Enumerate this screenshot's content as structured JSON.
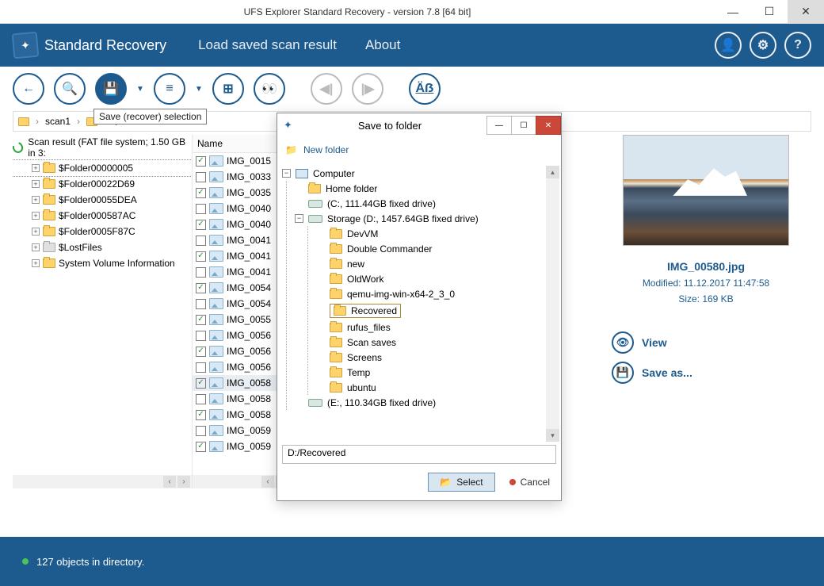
{
  "window": {
    "title": "UFS Explorer Standard Recovery - version 7.8 [64 bit]"
  },
  "banner": {
    "logo": "Standard Recovery",
    "menu_load": "Load saved scan result",
    "menu_about": "About"
  },
  "toolbar": {
    "tooltip_save": "Save (recover) selection"
  },
  "breadcrumb": {
    "item1": "scan1",
    "item2": "$...."
  },
  "tree": {
    "header": "Scan result (FAT file system; 1.50 GB in 3:",
    "items": [
      {
        "label": "$Folder00000005",
        "selected": true
      },
      {
        "label": "$Folder00022D69"
      },
      {
        "label": "$Folder00055DEA"
      },
      {
        "label": "$Folder000587AC"
      },
      {
        "label": "$Folder0005F87C"
      },
      {
        "label": "$LostFiles",
        "gray": true
      },
      {
        "label": "System Volume Information"
      }
    ]
  },
  "list": {
    "header": "Name",
    "items": [
      {
        "label": "IMG_0015",
        "checked": true
      },
      {
        "label": "IMG_0033"
      },
      {
        "label": "IMG_0035",
        "checked": true
      },
      {
        "label": "IMG_0040"
      },
      {
        "label": "IMG_0040",
        "checked": true
      },
      {
        "label": "IMG_0041"
      },
      {
        "label": "IMG_0041",
        "checked": true
      },
      {
        "label": "IMG_0041"
      },
      {
        "label": "IMG_0054",
        "checked": true
      },
      {
        "label": "IMG_0054"
      },
      {
        "label": "IMG_0055",
        "checked": true
      },
      {
        "label": "IMG_0056"
      },
      {
        "label": "IMG_0056",
        "checked": true
      },
      {
        "label": "IMG_0056"
      },
      {
        "label": "IMG_0058",
        "checked": true,
        "selected": true
      },
      {
        "label": "IMG_0058"
      },
      {
        "label": "IMG_0058",
        "checked": true
      },
      {
        "label": "IMG_0059"
      },
      {
        "label": "IMG_0059",
        "checked": true
      }
    ]
  },
  "preview": {
    "filename": "IMG_00580.jpg",
    "modified": "Modified: 11.12.2017 11:47:58",
    "size": "Size: 169 KB",
    "view": "View",
    "saveas": "Save as..."
  },
  "status": {
    "text": "127 objects in directory."
  },
  "dialog": {
    "title": "Save to folder",
    "new_folder": "New folder",
    "root": "Computer",
    "home": "Home folder",
    "drive_c": "(C:, 111.44GB fixed drive)",
    "drive_d": "Storage (D:, 1457.64GB fixed drive)",
    "d_children": [
      "DevVM",
      "Double Commander",
      "new",
      "OldWork",
      "qemu-img-win-x64-2_3_0",
      "Recovered",
      "rufus_files",
      "Scan saves",
      "Screens",
      "Temp",
      "ubuntu"
    ],
    "drive_e": "(E:, 110.34GB fixed drive)",
    "selected_child_index": 5,
    "path": "D:/Recovered",
    "btn_select": "Select",
    "btn_cancel": "Cancel"
  }
}
